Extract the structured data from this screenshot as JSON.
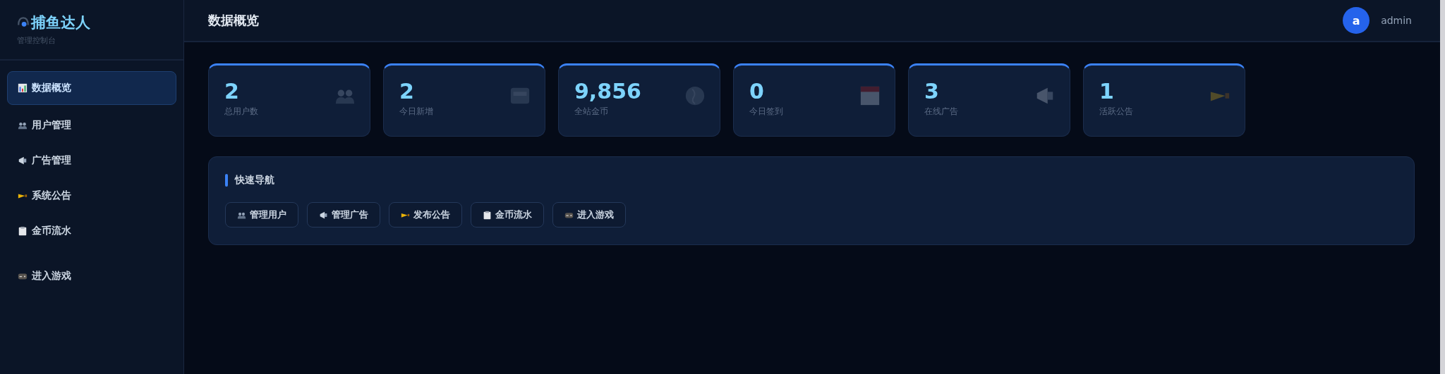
{
  "sidebar": {
    "brand": "捕鱼达人",
    "subtitle": "管理控制台",
    "items": [
      {
        "label": "数据概览",
        "selected": true
      },
      {
        "label": "用户管理",
        "selected": false
      },
      {
        "label": "广告管理",
        "selected": false
      },
      {
        "label": "系统公告",
        "selected": false
      },
      {
        "label": "金币流水",
        "selected": false
      },
      {
        "label": "进入游戏",
        "selected": false
      }
    ]
  },
  "header": {
    "title": "数据概览",
    "user": {
      "avatar": "a",
      "name": "admin"
    }
  },
  "stats": [
    {
      "value": "2",
      "label": "总用户数"
    },
    {
      "value": "2",
      "label": "今日新增"
    },
    {
      "value": "9,856",
      "label": "全站金币"
    },
    {
      "value": "0",
      "label": "今日签到"
    },
    {
      "value": "3",
      "label": "在线广告"
    },
    {
      "value": "1",
      "label": "活跃公告"
    }
  ],
  "quick_nav": {
    "title": "快速导航",
    "buttons": [
      "管理用户",
      "管理广告",
      "发布公告",
      "金币流水",
      "进入游戏"
    ]
  }
}
